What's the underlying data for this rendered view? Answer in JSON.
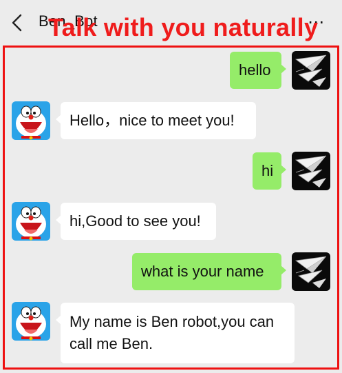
{
  "header": {
    "title": "Ben_Bot",
    "more_icon": "more-icon"
  },
  "banner": "Talk with you naturally",
  "conversation": [
    {
      "sender": "user",
      "text": "hello"
    },
    {
      "sender": "bot",
      "text": "Hello，nice to meet you!"
    },
    {
      "sender": "user",
      "text": "hi"
    },
    {
      "sender": "bot",
      "text": "hi,Good to see you!"
    },
    {
      "sender": "user",
      "text": "what is your name"
    },
    {
      "sender": "bot",
      "text": "My name is Ben robot,you can call me Ben."
    }
  ],
  "colors": {
    "background": "#ececec",
    "user_bubble": "#95ec69",
    "bot_bubble": "#ffffff",
    "highlight": "#ef1c1c"
  }
}
